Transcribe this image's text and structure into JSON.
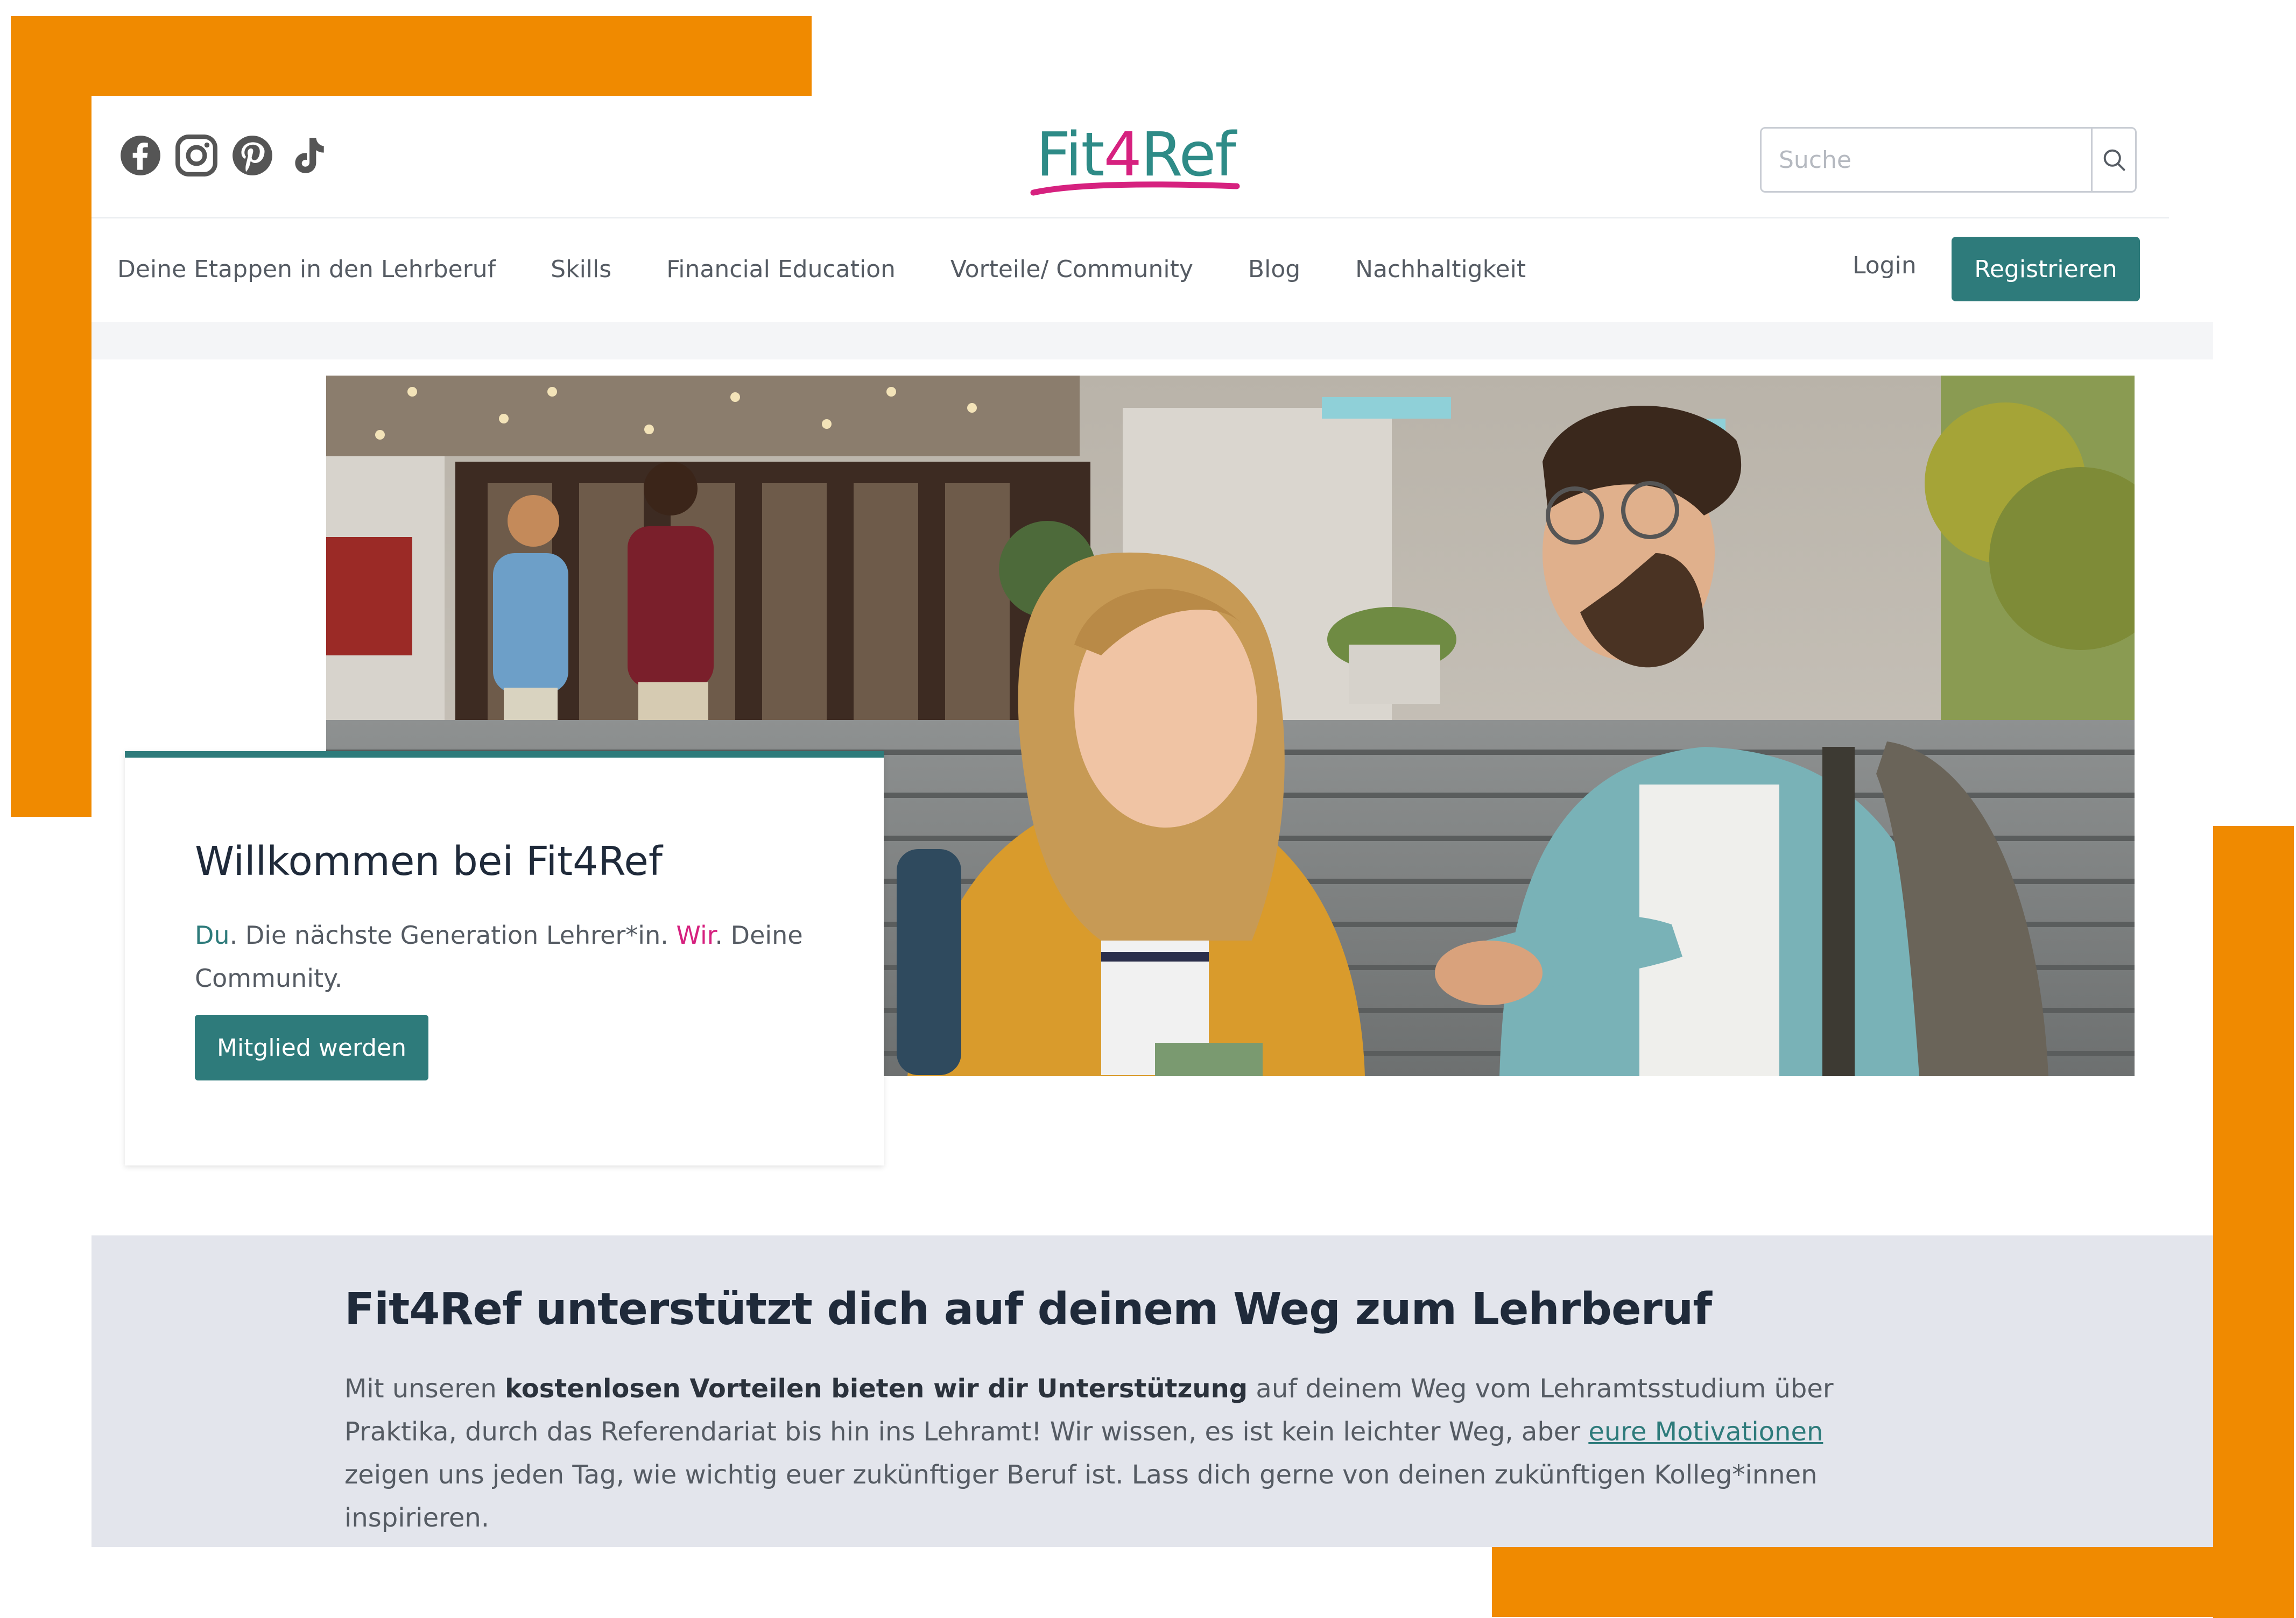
{
  "header": {
    "social_icons": [
      "facebook-icon",
      "instagram-icon",
      "pinterest-icon",
      "tiktok-icon"
    ],
    "logo": {
      "part1": "Fit",
      "part2": "4",
      "part3": "Ref"
    },
    "search": {
      "placeholder": "Suche",
      "icon": "search-icon"
    }
  },
  "nav": {
    "items": [
      "Deine Etappen in den Lehrberuf",
      "Skills",
      "Financial Education",
      "Vorteile/ Community",
      "Blog",
      "Nachhaltigkeit"
    ],
    "login": "Login",
    "register": "Registrieren"
  },
  "hero": {
    "title": "Willkommen bei Fit4Ref",
    "tagline": {
      "du": "Du",
      "middle": ". Die nächste Generation Lehrer*in. ",
      "wir": "Wir",
      "end": ". Deine Community."
    },
    "cta": "Mitglied werden"
  },
  "info": {
    "heading": "Fit4Ref unterstützt dich auf deinem Weg zum Lehrberuf",
    "p1": "Mit unseren ",
    "p_bold": "kostenlosen Vorteilen bieten wir dir Unterstützung",
    "p2": " auf deinem Weg vom Lehramtsstudium über Praktika, durch das Referendariat bis hin ins Lehramt! Wir wissen, es ist kein leichter Weg, aber ",
    "p_link": "eure Motivationen",
    "p3": " zeigen uns jeden Tag, wie wichtig euer zukünftiger Beruf ist. Lass dich gerne von deinen zukünftigen Kolleg*innen inspirieren."
  },
  "colors": {
    "accent": "#2e7b7b",
    "brand_pink": "#d6217f",
    "frame_orange": "#f08a00",
    "info_bg": "#e3e5ec"
  }
}
